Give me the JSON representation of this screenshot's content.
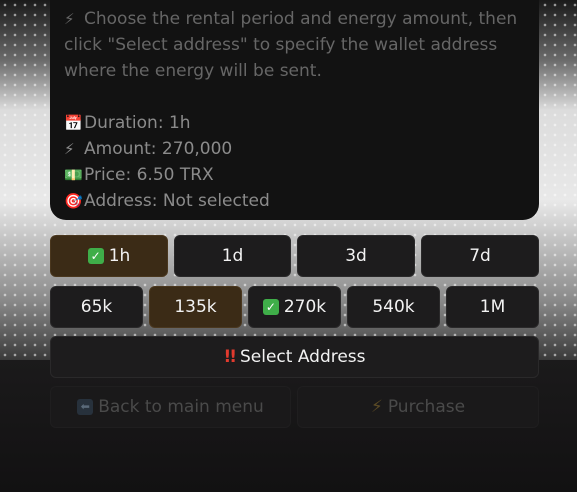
{
  "message": {
    "intro": "Choose the rental period and energy amount, then click \"Select address\" to specify the wallet address where the energy will be sent.",
    "lines": [
      {
        "icon": "calendar-icon",
        "glyph": "📅",
        "text": "Duration: 1h"
      },
      {
        "icon": "lightning-icon",
        "glyph": "⚡",
        "text": "Amount: 270,000"
      },
      {
        "icon": "money-icon",
        "glyph": "💵",
        "text": "Price: 6.50 TRX"
      },
      {
        "icon": "target-icon",
        "glyph": "🎯",
        "text": "Address: Not selected"
      }
    ]
  },
  "durations": [
    {
      "label": "1h",
      "selected": true
    },
    {
      "label": "1d",
      "selected": false
    },
    {
      "label": "3d",
      "selected": false
    },
    {
      "label": "7d",
      "selected": false
    }
  ],
  "amounts": [
    {
      "label": "65k",
      "selected": false,
      "highlight": false
    },
    {
      "label": "135k",
      "selected": false,
      "highlight": true
    },
    {
      "label": "270k",
      "selected": true,
      "highlight": false
    },
    {
      "label": "540k",
      "selected": false,
      "highlight": false
    },
    {
      "label": "1M",
      "selected": false,
      "highlight": false
    }
  ],
  "select_address": {
    "label": "Select Address"
  },
  "footer": {
    "back_label": "Back to main menu",
    "purchase_label": "Purchase"
  }
}
